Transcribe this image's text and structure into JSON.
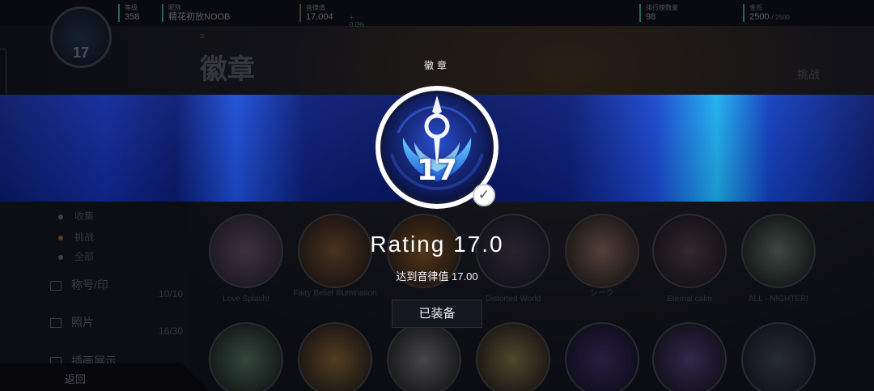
{
  "header": {
    "stats": [
      {
        "label": "等级",
        "value": "358"
      },
      {
        "label": "昵称",
        "value": "精花初放NOOB"
      },
      {
        "label": "音律值",
        "value": "17.004",
        "delta": "+ 0.0%"
      },
      {
        "label": "排行榜数量",
        "value": "98"
      },
      {
        "label": "金币",
        "value": "2500",
        "extra": "/ 2500"
      }
    ],
    "avatar_level": "17"
  },
  "page": {
    "title": "徽章",
    "challenge": "挑战"
  },
  "sidebar": {
    "rows": [
      {
        "label": "收集"
      },
      {
        "label": "挑战"
      },
      {
        "label": "全部"
      }
    ],
    "menu": [
      {
        "label": "称号/印",
        "count": ""
      },
      {
        "label": "照片",
        "count": "10/10"
      },
      {
        "label": "插画展示",
        "count": "16/30"
      }
    ],
    "back": "返回"
  },
  "grid": {
    "labels": [
      "Love Splash!",
      "Fairy Belief Illumination",
      "",
      "Distorted World",
      "シーク",
      "Eternal calm",
      "ALL - NIGHTER!"
    ]
  },
  "modal": {
    "caption": "徽章",
    "badge_number": "17",
    "title": "Rating 17.0",
    "subtitle": "达到音律值 17.00",
    "button": "已装备",
    "equipped": true,
    "accent": "#1d4fd8"
  }
}
